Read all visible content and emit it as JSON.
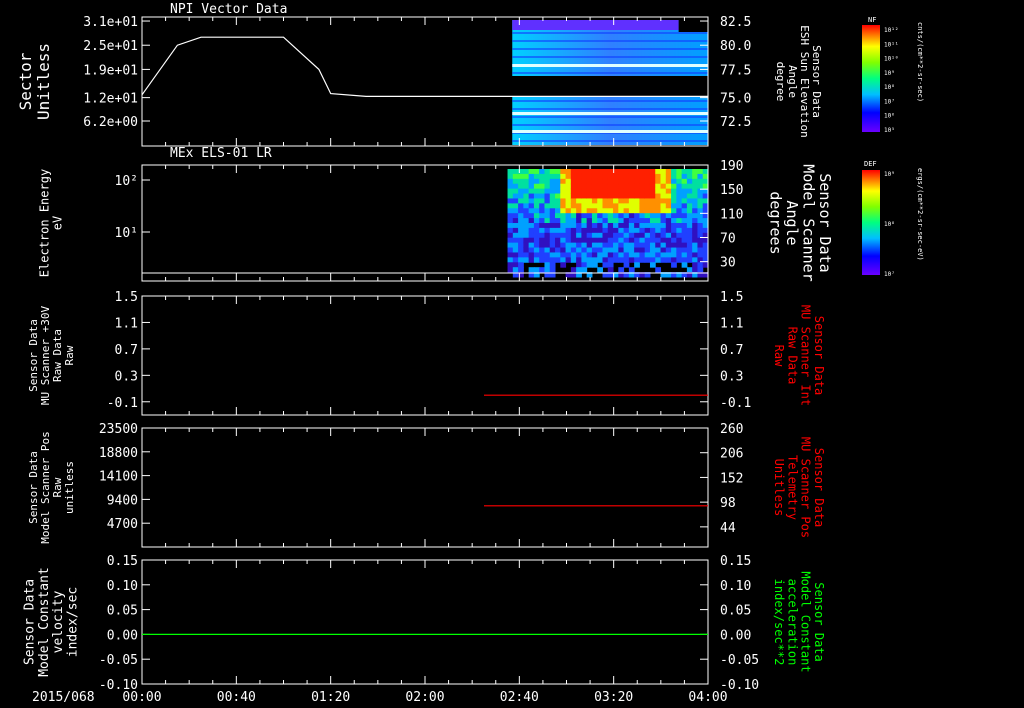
{
  "colors": {
    "white": "#ffffff",
    "red": "#ff0000",
    "green": "#00ff00",
    "black": "#000000"
  },
  "date_label": "2015/068",
  "time_ticks": [
    "00:00",
    "00:40",
    "01:20",
    "02:00",
    "02:40",
    "03:20",
    "04:00"
  ],
  "time_values_min": [
    0,
    40,
    80,
    120,
    160,
    200,
    240
  ],
  "chart_data": [
    {
      "type": "line",
      "title": "NPI Vector Data",
      "ylabel": [
        "Sector",
        "Unitless"
      ],
      "yticks": [
        "3.1e+01",
        "2.5e+01",
        "1.9e+01",
        "1.2e+01",
        "6.2e+00"
      ],
      "ytick_values": [
        31,
        25,
        19,
        12,
        6.2
      ],
      "ylim": [
        0,
        32
      ],
      "right_ylabel": [
        "Sensor Data",
        "ESH Sun Elevation",
        "Angle",
        "degree"
      ],
      "right_yticks": [
        "82.5",
        "80.0",
        "77.5",
        "75.0",
        "72.5"
      ],
      "right_ylim": [
        70,
        82.5
      ],
      "series": [
        {
          "x": [
            0,
            15,
            25,
            50,
            60,
            75,
            80,
            95,
            240
          ],
          "y": [
            12.7,
            25,
            27,
            27,
            27,
            19,
            13,
            12.3,
            12.3
          ]
        }
      ],
      "heatmap_start_min": 157,
      "colorbar": {
        "label": "NF",
        "scale_label": "cnts/(cm**2-sr-sec)",
        "ticks": [
          "10¹²",
          "10¹¹",
          "10¹⁰",
          "10⁹",
          "10⁸",
          "10⁷",
          "10⁶",
          "10⁵"
        ]
      }
    },
    {
      "type": "heatmap",
      "title": "MEx ELS-01 LR",
      "ylabel": [
        "Electron Energy",
        "eV"
      ],
      "yticks": [
        "10²",
        "10¹"
      ],
      "right_ylabel": [
        "Sensor Data",
        "Model Scanner",
        "Angle",
        "degrees"
      ],
      "right_yticks": [
        "190",
        "150",
        "110",
        "70",
        "30"
      ],
      "right_ylim": [
        0,
        190
      ],
      "heatmap_start_min": 155,
      "colorbar": {
        "label": "DEF",
        "scale_label": "ergs/(cm**2-sr-sec-eV)",
        "ticks": [
          "10⁹",
          "10⁸",
          "10⁷"
        ]
      }
    },
    {
      "type": "line",
      "ylabel": [
        "Sensor Data",
        "MU Scanner +30V",
        "Raw Data",
        "Raw"
      ],
      "yticks": [
        "1.5",
        "1.1",
        "0.7",
        "0.3",
        "-0.1"
      ],
      "ytick_values": [
        1.5,
        1.1,
        0.7,
        0.3,
        -0.1
      ],
      "ylim": [
        -0.3,
        1.5
      ],
      "right_ylabel": [
        "Sensor Data",
        "MU Scanner Int",
        "Raw Data",
        "Raw"
      ],
      "right_yticks": [
        "1.5",
        "1.1",
        "0.7",
        "0.3",
        "-0.1"
      ],
      "series": [
        {
          "x": [
            145,
            240
          ],
          "y": [
            0,
            0
          ]
        }
      ]
    },
    {
      "type": "line",
      "ylabel": [
        "Sensor Data",
        "Model Scanner Pos",
        "Raw",
        "unitless"
      ],
      "yticks": [
        "23500",
        "18800",
        "14100",
        "9400",
        "4700"
      ],
      "ytick_values": [
        23500,
        18800,
        14100,
        9400,
        4700
      ],
      "ylim": [
        0,
        23500
      ],
      "right_ylabel": [
        "Sensor Data",
        "MU Scanner Pos",
        "Telemetry",
        "Unitless"
      ],
      "right_yticks": [
        "260",
        "206",
        "152",
        "98",
        "44"
      ],
      "right_ytick_values": [
        260,
        206,
        152,
        98,
        44
      ],
      "right_ylim": [
        0,
        260
      ],
      "series": [
        {
          "x": [
            145,
            240
          ],
          "y": [
            90,
            90
          ],
          "axis": "right"
        }
      ]
    },
    {
      "type": "line",
      "ylabel": [
        "Sensor Data",
        "Model Constant",
        "velocity",
        "index/sec"
      ],
      "yticks": [
        "0.15",
        "0.10",
        "0.05",
        "0.00",
        "-0.05",
        "-0.10"
      ],
      "ytick_values": [
        0.15,
        0.1,
        0.05,
        0.0,
        -0.05,
        -0.1
      ],
      "ylim": [
        -0.1,
        0.15
      ],
      "right_ylabel": [
        "Sensor Data",
        "Model Constant",
        "acceleration",
        "index/sec**2"
      ],
      "right_yticks": [
        "0.15",
        "0.10",
        "0.05",
        "0.00",
        "-0.05",
        "-0.10"
      ],
      "series": [
        {
          "x": [
            0,
            240
          ],
          "y": [
            0,
            0
          ]
        }
      ]
    }
  ]
}
